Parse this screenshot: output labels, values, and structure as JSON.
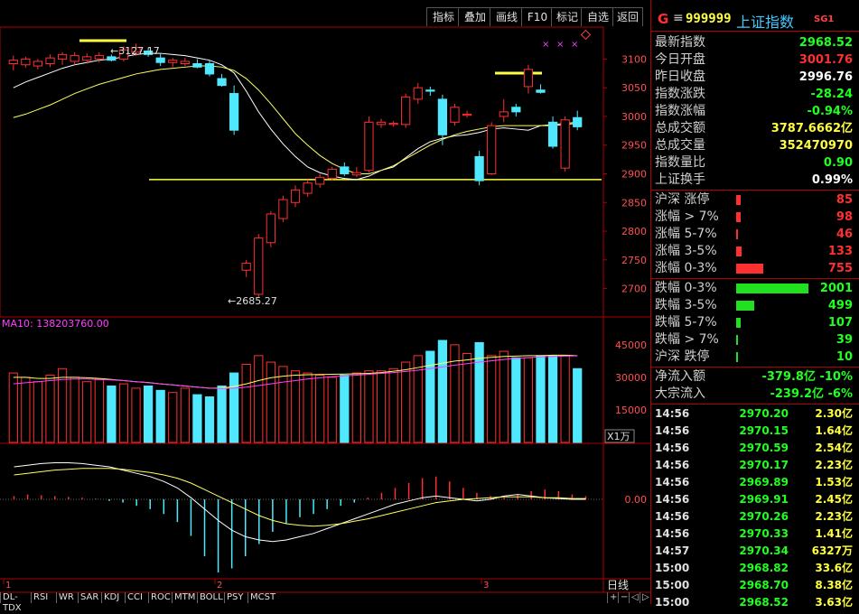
{
  "toolbar": {
    "buttons": [
      "指标",
      "叠加",
      "画线",
      "F10",
      "标记",
      "自选",
      "返回"
    ],
    "top_caption": "上证指数"
  },
  "chart": {
    "price_axis": [
      "3100",
      "3050",
      "3000",
      "2950",
      "2900",
      "2850",
      "2800",
      "2750",
      "2700"
    ],
    "high_label": "3127.17",
    "low_label": "2685.27",
    "volume_caption": "MA10: 138203760.00",
    "volume_axis": [
      "45000",
      "30000",
      "15000"
    ],
    "volume_unit": "X1万",
    "macd_axis": [
      "0.00"
    ],
    "date_ticks": [
      "1",
      "2",
      "3"
    ],
    "period_label": "日线",
    "markers": [
      "×",
      "×",
      "×"
    ],
    "colors": {
      "up": "#ff3030",
      "down": "#50e8ff",
      "ma1": "#ffffff",
      "ma2": "#ffff60",
      "ma3": "#ff40ff",
      "support": "#ffff40"
    }
  },
  "chart_data": {
    "type": "candlestick",
    "candles": [
      {
        "o": 3092,
        "h": 3106,
        "l": 3080,
        "c": 3098
      },
      {
        "o": 3090,
        "h": 3104,
        "l": 3085,
        "c": 3100
      },
      {
        "o": 3088,
        "h": 3100,
        "l": 3082,
        "c": 3096
      },
      {
        "o": 3092,
        "h": 3108,
        "l": 3086,
        "c": 3102
      },
      {
        "o": 3100,
        "h": 3112,
        "l": 3090,
        "c": 3108
      },
      {
        "o": 3096,
        "h": 3112,
        "l": 3090,
        "c": 3106
      },
      {
        "o": 3098,
        "h": 3110,
        "l": 3092,
        "c": 3104
      },
      {
        "o": 3100,
        "h": 3112,
        "l": 3094,
        "c": 3106
      },
      {
        "o": 3104,
        "h": 3108,
        "l": 3096,
        "c": 3098
      },
      {
        "o": 3100,
        "h": 3122,
        "l": 3096,
        "c": 3116
      },
      {
        "o": 3112,
        "h": 3127,
        "l": 3106,
        "c": 3120
      },
      {
        "o": 3114,
        "h": 3120,
        "l": 3104,
        "c": 3108
      },
      {
        "o": 3102,
        "h": 3110,
        "l": 3088,
        "c": 3094
      },
      {
        "o": 3094,
        "h": 3102,
        "l": 3086,
        "c": 3098
      },
      {
        "o": 3092,
        "h": 3102,
        "l": 3088,
        "c": 3096
      },
      {
        "o": 3092,
        "h": 3100,
        "l": 3084,
        "c": 3086
      },
      {
        "o": 3092,
        "h": 3098,
        "l": 3070,
        "c": 3074
      },
      {
        "o": 3066,
        "h": 3074,
        "l": 3052,
        "c": 3054
      },
      {
        "o": 3040,
        "h": 3054,
        "l": 2968,
        "c": 2976
      },
      {
        "o": 2732,
        "h": 2750,
        "l": 2720,
        "c": 2744
      },
      {
        "o": 2690,
        "h": 2795,
        "l": 2685,
        "c": 2788
      },
      {
        "o": 2780,
        "h": 2835,
        "l": 2772,
        "c": 2830
      },
      {
        "o": 2822,
        "h": 2862,
        "l": 2816,
        "c": 2855
      },
      {
        "o": 2850,
        "h": 2880,
        "l": 2842,
        "c": 2872
      },
      {
        "o": 2866,
        "h": 2890,
        "l": 2860,
        "c": 2884
      },
      {
        "o": 2882,
        "h": 2900,
        "l": 2876,
        "c": 2894
      },
      {
        "o": 2892,
        "h": 2912,
        "l": 2888,
        "c": 2908
      },
      {
        "o": 2912,
        "h": 2920,
        "l": 2896,
        "c": 2900
      },
      {
        "o": 2898,
        "h": 2912,
        "l": 2894,
        "c": 2902
      },
      {
        "o": 2906,
        "h": 3000,
        "l": 2902,
        "c": 2990
      },
      {
        "o": 2986,
        "h": 2996,
        "l": 2980,
        "c": 2990
      },
      {
        "o": 2986,
        "h": 2992,
        "l": 2982,
        "c": 2988
      },
      {
        "o": 2986,
        "h": 3040,
        "l": 2980,
        "c": 3034
      },
      {
        "o": 3030,
        "h": 3058,
        "l": 3022,
        "c": 3050
      },
      {
        "o": 3046,
        "h": 3052,
        "l": 3036,
        "c": 3044
      },
      {
        "o": 3030,
        "h": 3038,
        "l": 2950,
        "c": 2968
      },
      {
        "o": 2990,
        "h": 3022,
        "l": 2984,
        "c": 3016
      },
      {
        "o": 3002,
        "h": 3010,
        "l": 2998,
        "c": 3004
      },
      {
        "o": 2930,
        "h": 2940,
        "l": 2880,
        "c": 2888
      },
      {
        "o": 2900,
        "h": 2990,
        "l": 2898,
        "c": 2984
      },
      {
        "o": 3000,
        "h": 3030,
        "l": 2990,
        "c": 3008
      },
      {
        "o": 3016,
        "h": 3022,
        "l": 3000,
        "c": 3008
      },
      {
        "o": 3052,
        "h": 3090,
        "l": 3040,
        "c": 3082
      },
      {
        "o": 3046,
        "h": 3056,
        "l": 3040,
        "c": 3042
      },
      {
        "o": 2990,
        "h": 3000,
        "l": 2944,
        "c": 2948
      },
      {
        "o": 2910,
        "h": 3000,
        "l": 2904,
        "c": 2994
      },
      {
        "o": 2998,
        "h": 3010,
        "l": 2976,
        "c": 2982
      }
    ],
    "ma_fast": [
      3050,
      3060,
      3068,
      3076,
      3084,
      3090,
      3094,
      3098,
      3100,
      3104,
      3108,
      3110,
      3110,
      3108,
      3106,
      3102,
      3098,
      3090,
      3076,
      3044,
      3008,
      2978,
      2952,
      2930,
      2912,
      2902,
      2896,
      2892,
      2890,
      2896,
      2906,
      2912,
      2928,
      2944,
      2956,
      2962,
      2966,
      2968,
      2972,
      2978,
      2980,
      2978,
      2976,
      2984,
      2984,
      2986,
      2988
    ],
    "ma_slow": [
      2998,
      3004,
      3012,
      3020,
      3030,
      3040,
      3048,
      3056,
      3062,
      3068,
      3074,
      3078,
      3082,
      3084,
      3086,
      3088,
      3088,
      3086,
      3080,
      3066,
      3046,
      3022,
      2996,
      2970,
      2950,
      2932,
      2918,
      2908,
      2900,
      2900,
      2906,
      2914,
      2926,
      2938,
      2950,
      2960,
      2968,
      2974,
      2978,
      2982,
      2984,
      2984,
      2984,
      2984,
      2986,
      2988,
      2990
    ],
    "volumes": [
      32000,
      30000,
      28000,
      31000,
      34000,
      30000,
      28000,
      29000,
      26000,
      27000,
      25000,
      26000,
      24000,
      23000,
      25000,
      22000,
      21000,
      26000,
      32000,
      36000,
      40000,
      37000,
      35000,
      33000,
      32000,
      31000,
      30000,
      31000,
      32000,
      33000,
      33000,
      34000,
      37000,
      40000,
      42000,
      47000,
      45000,
      41000,
      46000,
      40000,
      42000,
      39000,
      39000,
      40000,
      40000,
      40000,
      34000
    ],
    "vol_ma": [
      30000,
      30000,
      29500,
      29500,
      30000,
      30000,
      29800,
      29500,
      29000,
      28500,
      28000,
      27600,
      27000,
      26500,
      26000,
      25500,
      25000,
      25000,
      25800,
      27000,
      28500,
      29800,
      30500,
      31000,
      31200,
      31300,
      31400,
      31500,
      31600,
      31800,
      32200,
      32800,
      33500,
      34500,
      35500,
      36500,
      37500,
      38000,
      38800,
      39200,
      39600,
      39800,
      40000,
      40000,
      40200,
      40200,
      40000
    ],
    "vol_ma2": [
      27000,
      27500,
      28000,
      28500,
      29000,
      29200,
      29200,
      29000,
      28800,
      28500,
      28000,
      27500,
      27000,
      26500,
      26000,
      25500,
      25000,
      24800,
      25000,
      25500,
      26200,
      27000,
      27800,
      28500,
      29200,
      29800,
      30300,
      30700,
      31000,
      31400,
      31800,
      32200,
      32700,
      33300,
      34000,
      34800,
      35600,
      36300,
      37000,
      37600,
      38200,
      38700,
      39100,
      39400,
      39600,
      39800,
      39900
    ],
    "macd_hist": [
      4,
      6,
      5,
      4,
      3,
      2,
      1,
      -2,
      -4,
      -8,
      -12,
      -18,
      -28,
      -45,
      -70,
      -90,
      -85,
      -70,
      -55,
      -40,
      -30,
      -22,
      -18,
      -12,
      -8,
      -4,
      2,
      8,
      14,
      20,
      26,
      28,
      22,
      14,
      8,
      4,
      2,
      6,
      10,
      12,
      10,
      6,
      4
    ],
    "dif": [
      40,
      42,
      44,
      45,
      45,
      44,
      42,
      40,
      36,
      32,
      28,
      22,
      14,
      2,
      -12,
      -26,
      -38,
      -46,
      -50,
      -52,
      -50,
      -46,
      -42,
      -36,
      -30,
      -24,
      -18,
      -12,
      -6,
      -2,
      2,
      4,
      2,
      0,
      -2,
      0,
      4,
      6,
      4,
      2,
      1,
      0,
      0
    ],
    "dea": [
      30,
      32,
      34,
      36,
      37,
      38,
      38,
      38,
      37,
      35,
      33,
      30,
      26,
      20,
      12,
      4,
      -4,
      -12,
      -20,
      -26,
      -30,
      -32,
      -33,
      -32,
      -30,
      -27,
      -24,
      -20,
      -16,
      -12,
      -8,
      -4,
      -2,
      0,
      1,
      2,
      3,
      3,
      3,
      2,
      2,
      1,
      1
    ]
  },
  "panel": {
    "header": {
      "g": "G",
      "menu": "≡",
      "code": "999999",
      "name": "上证指数",
      "sg": "SG1"
    },
    "stats": [
      {
        "label": "最新指数",
        "value": "2968.52",
        "color": "#20ff20"
      },
      {
        "label": "今日开盘",
        "value": "3001.76",
        "color": "#ff3030"
      },
      {
        "label": "昨日收盘",
        "value": "2996.76",
        "color": "#ffffff"
      },
      {
        "label": "指数涨跌",
        "value": "-28.24",
        "color": "#20ff20"
      },
      {
        "label": "指数涨幅",
        "value": "-0.94%",
        "color": "#20ff20"
      },
      {
        "label": "总成交额",
        "value": "3787.6662亿",
        "color": "#ffff40"
      },
      {
        "label": "总成交量",
        "value": "352470970",
        "color": "#ffff40"
      },
      {
        "label": "指数量比",
        "value": "0.90",
        "color": "#20ff20"
      },
      {
        "label": "上证换手",
        "value": "0.99%",
        "color": "#ffffff"
      }
    ],
    "breadth_up": [
      {
        "label": "沪深 涨停",
        "value": "85",
        "ratio": 0.06
      },
      {
        "label": "涨幅 > 7%",
        "value": "98",
        "ratio": 0.06
      },
      {
        "label": "涨幅 5-7%",
        "value": "46",
        "ratio": 0.02
      },
      {
        "label": "涨幅 3-5%",
        "value": "133",
        "ratio": 0.08
      },
      {
        "label": "涨幅 0-3%",
        "value": "755",
        "ratio": 0.38
      }
    ],
    "breadth_down": [
      {
        "label": "跌幅 0-3%",
        "value": "2001",
        "ratio": 1.0
      },
      {
        "label": "跌幅 3-5%",
        "value": "499",
        "ratio": 0.25
      },
      {
        "label": "跌幅 5-7%",
        "value": "107",
        "ratio": 0.06
      },
      {
        "label": "跌幅 > 7%",
        "value": "39",
        "ratio": 0.02
      },
      {
        "label": "沪深 跌停",
        "value": "10",
        "ratio": 0.01
      }
    ],
    "flows": [
      {
        "label": "净流入额",
        "value": "-379.8亿  -10%"
      },
      {
        "label": "大宗流入",
        "value": "-239.2亿  -6%"
      }
    ],
    "ticks": [
      {
        "time": "14:56",
        "price": "2970.20",
        "vol": "2.30亿"
      },
      {
        "time": "14:56",
        "price": "2970.15",
        "vol": "1.64亿"
      },
      {
        "time": "14:56",
        "price": "2970.59",
        "vol": "2.54亿"
      },
      {
        "time": "14:56",
        "price": "2970.17",
        "vol": "2.23亿"
      },
      {
        "time": "14:56",
        "price": "2969.89",
        "vol": "1.53亿"
      },
      {
        "time": "14:56",
        "price": "2969.91",
        "vol": "2.45亿"
      },
      {
        "time": "14:56",
        "price": "2970.26",
        "vol": "2.23亿"
      },
      {
        "time": "14:56",
        "price": "2970.33",
        "vol": "1.41亿"
      },
      {
        "time": "14:57",
        "price": "2970.34",
        "vol": "6327万"
      },
      {
        "time": "15:00",
        "price": "2968.82",
        "vol": "33.6亿"
      },
      {
        "time": "15:00",
        "price": "2968.70",
        "vol": "8.38亿"
      },
      {
        "time": "15:00",
        "price": "2968.52",
        "vol": "3.63亿"
      }
    ]
  },
  "bottom_tabs": [
    "DL-TDX",
    "RSI",
    "WR",
    "SAR",
    "KDJ",
    "CCI",
    "ROC",
    "MTM",
    "BOLL",
    "PSY",
    "MCST"
  ]
}
